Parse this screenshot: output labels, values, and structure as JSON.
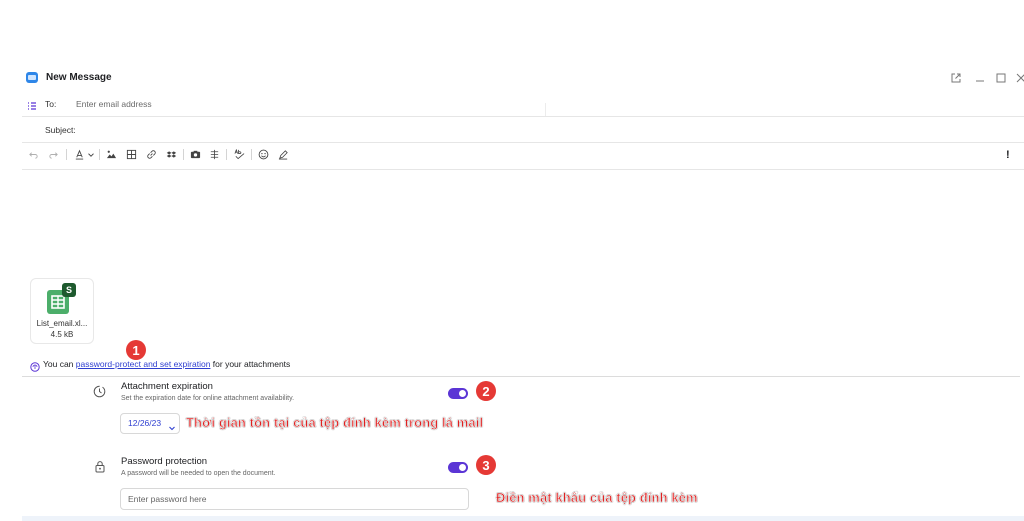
{
  "window": {
    "title": "New Message",
    "to_label": "To:",
    "to_placeholder": "Enter email address",
    "subject_label": "Subject:",
    "more_glyph": "!"
  },
  "toolbar": {
    "icons": [
      "undo-icon",
      "redo-icon",
      "font-color-icon",
      "chevron-down-icon",
      "image-icon",
      "table-icon",
      "link-icon",
      "dropbox-icon",
      "camera-icon",
      "strikethrough-icon",
      "spellcheck-icon",
      "emoji-icon",
      "pen-icon"
    ]
  },
  "attachment": {
    "file_name": "List_email.xl...",
    "file_size": "4.5 kB",
    "badge_letter": "S",
    "accent": "#4cae6a"
  },
  "notice": {
    "prefix": "You can ",
    "link": "password-protect and set expiration",
    "suffix": " for your attachments"
  },
  "expiration": {
    "title": "Attachment expiration",
    "desc": "Set the expiration date for online attachment availability.",
    "date": "12/26/23",
    "enabled": true
  },
  "password": {
    "title": "Password protection",
    "desc": "A password will be needed to open the document.",
    "placeholder": "Enter password here",
    "enabled": true
  },
  "annotations": {
    "badge1": "1",
    "badge2": "2",
    "badge3": "3",
    "note_expiration": "Thời gian tồn tại của tệp đính kèm trong lá mail",
    "note_password": "Điền mật khẩu của tệp đính kèm"
  },
  "colors": {
    "accent": "#5b35d5",
    "annotation": "#e53935",
    "link": "#2f3fd0"
  }
}
